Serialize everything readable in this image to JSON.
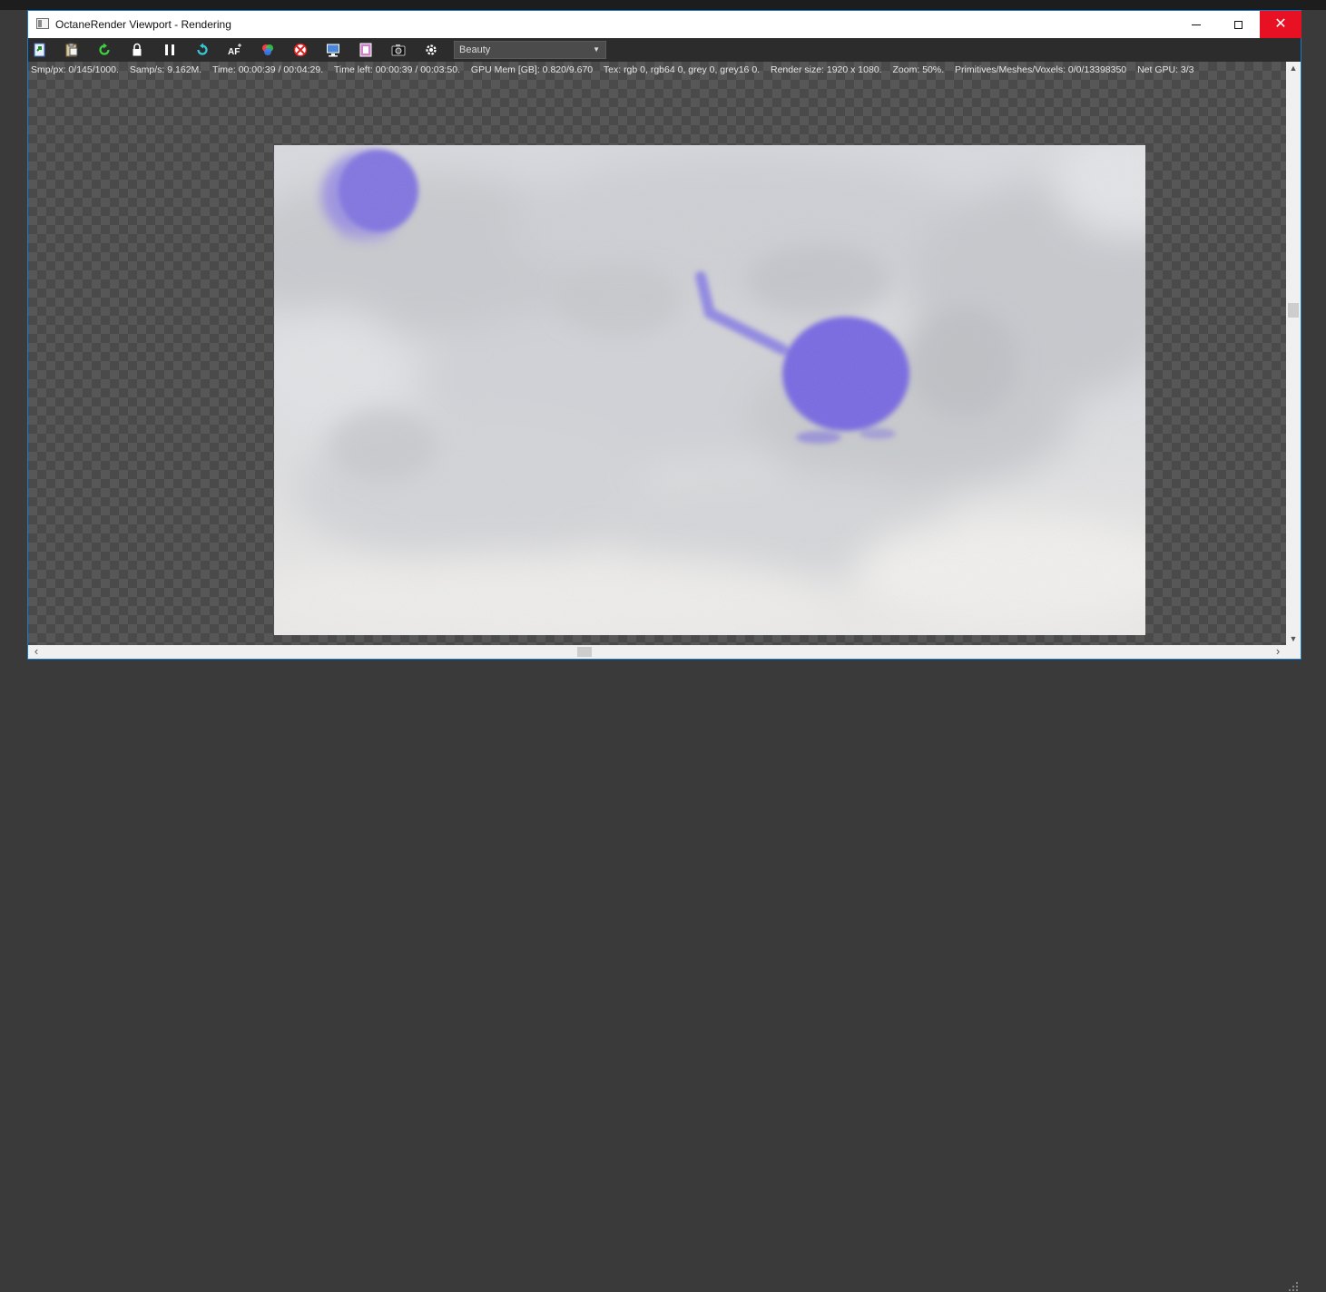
{
  "window": {
    "title": "OctaneRender Viewport - Rendering"
  },
  "toolbar": {
    "buttons": [
      {
        "icon": "export-icon",
        "tooltip": ""
      },
      {
        "icon": "clipboard-icon",
        "tooltip": ""
      },
      {
        "icon": "restart-icon",
        "tooltip": ""
      },
      {
        "icon": "lock-icon",
        "tooltip": ""
      },
      {
        "icon": "pause-icon",
        "tooltip": ""
      },
      {
        "icon": "reset-camera-icon",
        "tooltip": ""
      },
      {
        "icon": "autofocus-icon",
        "tooltip": ""
      },
      {
        "icon": "color-picker-icon",
        "tooltip": ""
      },
      {
        "icon": "region-icon",
        "tooltip": ""
      },
      {
        "icon": "display-icon",
        "tooltip": ""
      },
      {
        "icon": "film-icon",
        "tooltip": ""
      },
      {
        "icon": "camera-icon",
        "tooltip": ""
      },
      {
        "icon": "settings-icon",
        "tooltip": ""
      }
    ],
    "render_pass": "Beauty",
    "af_label": "AF"
  },
  "status": {
    "samples_per_px": "Smp/px: 0/145/1000.",
    "samples_per_sec": "Samp/s: 9.162M.",
    "time": "Time: 00:00:39 / 00:04:29.",
    "time_left": "Time left: 00:00:39 / 00:03:50.",
    "gpu_mem": "GPU Mem [GB]: 0.820/9.670",
    "textures": "Tex: rgb 0, rgb64 0, grey 0, grey16 0.",
    "render_size": "Render size: 1920 x 1080.",
    "zoom": "Zoom: 50%.",
    "primitives": "Primitives/Meshes/Voxels: 0/0/13398350",
    "net_gpu": "Net GPU: 3/3"
  },
  "colors": {
    "accent": "#1979ca",
    "close_red": "#e81123",
    "viewport_bg": "#4a4a4a",
    "blob_purple": "#7b6fe6",
    "cloud_white": "#e6e8ec"
  }
}
